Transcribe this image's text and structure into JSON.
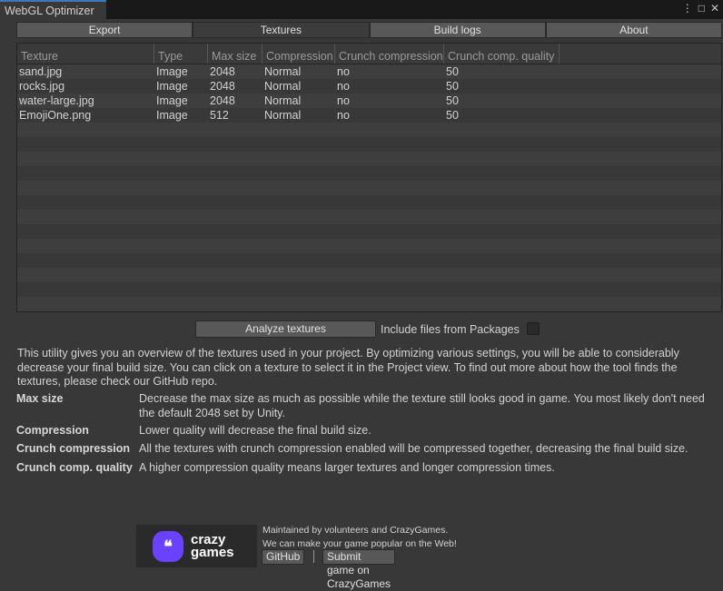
{
  "window": {
    "title": "WebGL Optimizer",
    "menu_icon": "⋮",
    "maximize_icon": "□",
    "close_icon": "✕"
  },
  "tabs": [
    {
      "label": "Export"
    },
    {
      "label": "Textures"
    },
    {
      "label": "Build logs"
    },
    {
      "label": "About"
    }
  ],
  "table": {
    "columns": [
      "Texture",
      "Type",
      "Max size",
      "Compression",
      "Crunch compression",
      "Crunch comp. quality"
    ],
    "rows": [
      [
        "sand.jpg",
        "Image",
        "2048",
        "Normal",
        "no",
        "50"
      ],
      [
        "rocks.jpg",
        "Image",
        "2048",
        "Normal",
        "no",
        "50"
      ],
      [
        "water-large.jpg",
        "Image",
        "2048",
        "Normal",
        "no",
        "50"
      ],
      [
        "EmojiOne.png",
        "Image",
        "512",
        "Normal",
        "no",
        "50"
      ]
    ]
  },
  "analyze_label": "Analyze textures",
  "include_packages_label": "Include files from Packages",
  "intro": "This utility gives you an overview of the textures used in your project. By optimizing various settings, you will be able to considerably decrease your final build size. You can click on a texture to select it in the Project view. To find out more about how the tool finds the textures, please check our GitHub repo.",
  "definitions": [
    {
      "term": "Max size",
      "desc": "Decrease the max size as much as possible while the texture still looks good in game. You most likely don't need the default 2048 set by Unity."
    },
    {
      "term": "Compression",
      "desc": "Lower quality will decrease the final build size."
    },
    {
      "term": "Crunch compression",
      "desc": "All the textures with crunch compression enabled will be compressed together, decreasing the final build size."
    },
    {
      "term": "Crunch comp. quality",
      "desc": "A higher compression quality means larger textures and longer compression times."
    }
  ],
  "footer": {
    "logo_line1": "crazy",
    "logo_line2": "games",
    "line1": "Maintained by volunteers and CrazyGames.",
    "line2": "We can make your game popular on the Web!",
    "github_label": "GitHub",
    "submit_label": "Submit game on CrazyGames"
  }
}
